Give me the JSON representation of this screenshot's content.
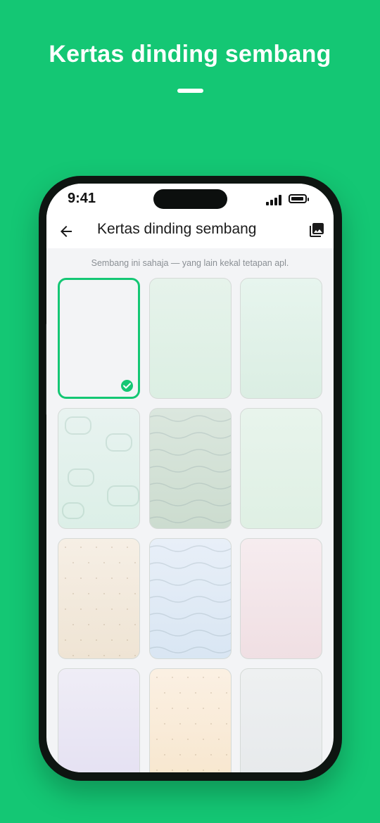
{
  "headline": "Kertas dinding sembang",
  "status_bar": {
    "time": "9:41"
  },
  "app_bar": {
    "title": "Kertas dinding sembang"
  },
  "hint": "Sembang ini sahaja — yang lain kekal tetapan apl.",
  "wallpapers": [
    {
      "name": "default",
      "top": "#f3f4f6",
      "bottom": "#f3f4f6",
      "pattern": "none",
      "selected": true
    },
    {
      "name": "mint",
      "top": "#e6f3eb",
      "bottom": "#dcefe3",
      "pattern": "none",
      "selected": false
    },
    {
      "name": "mint-light",
      "top": "#e7f5ee",
      "bottom": "#dbeee3",
      "pattern": "none",
      "selected": false
    },
    {
      "name": "mint-bubbles",
      "top": "#e8f3f0",
      "bottom": "#dcefe7",
      "pattern": "bubbles",
      "selected": false
    },
    {
      "name": "sage-waves",
      "top": "#dbe7de",
      "bottom": "#ccdccf",
      "pattern": "waves",
      "selected": false
    },
    {
      "name": "mint-soft",
      "top": "#e8f4ec",
      "bottom": "#dff0e4",
      "pattern": "none",
      "selected": false
    },
    {
      "name": "sand-dots",
      "top": "#f6efe5",
      "bottom": "#efe4d4",
      "pattern": "dots",
      "selected": false
    },
    {
      "name": "sky-waves",
      "top": "#e8eff8",
      "bottom": "#d9e6f3",
      "pattern": "waves",
      "selected": false
    },
    {
      "name": "blush",
      "top": "#f6ecef",
      "bottom": "#f0dfe3",
      "pattern": "none",
      "selected": false
    },
    {
      "name": "lavender",
      "top": "#efedf6",
      "bottom": "#e4e0f2",
      "pattern": "none",
      "selected": false
    },
    {
      "name": "cream-dots",
      "top": "#fbf0e3",
      "bottom": "#f7e6cd",
      "pattern": "dots",
      "selected": false
    },
    {
      "name": "mist",
      "top": "#eef0f1",
      "bottom": "#e6e9eb",
      "pattern": "none",
      "selected": false
    }
  ],
  "icons": {
    "back": "arrow-left-icon",
    "gallery": "photo-library-icon",
    "selected": "check-circle-icon"
  },
  "colors": {
    "brand": "#14c774"
  }
}
